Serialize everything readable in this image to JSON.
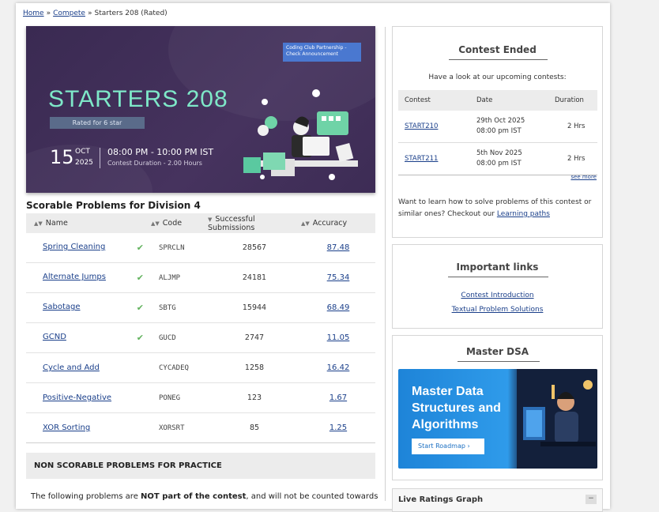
{
  "breadcrumb": {
    "home": "Home",
    "sep": "»",
    "compete": "Compete",
    "current": "Starters 208 (Rated)"
  },
  "banner": {
    "partner": "Coding Club Partnership - Check Announcement",
    "title": "STARTERS 208",
    "rated": "Rated for 6 star",
    "day": "15",
    "month": "OCT",
    "year": "2025",
    "time": "08:00 PM - 10:00 PM IST",
    "duration": "Contest Duration - 2.00 Hours"
  },
  "problems": {
    "section_title": "Scorable Problems for Division 4",
    "headers": {
      "name": "Name",
      "code": "Code",
      "subs": "Successful Submissions",
      "acc": "Accuracy"
    },
    "check": "✔",
    "rows": [
      {
        "name": "Spring Cleaning",
        "code": "SPRCLN",
        "subs": "28567",
        "acc": "87.48"
      },
      {
        "name": "Alternate Jumps",
        "code": "ALJMP",
        "subs": "24181",
        "acc": "75.34"
      },
      {
        "name": "Sabotage",
        "code": "SBTG",
        "subs": "15944",
        "acc": "68.49"
      },
      {
        "name": "GCND",
        "code": "GUCD",
        "subs": "2747",
        "acc": "11.05"
      },
      {
        "name": "Cycle and Add",
        "code": "CYCADEQ",
        "subs": "1258",
        "acc": "16.42"
      },
      {
        "name": "Positive-Negative",
        "code": "PONEG",
        "subs": "123",
        "acc": "1.67"
      },
      {
        "name": "XOR Sorting",
        "code": "XORSRT",
        "subs": "85",
        "acc": "1.25"
      }
    ]
  },
  "non_scorable": {
    "title": "NON SCORABLE PROBLEMS FOR PRACTICE",
    "text_pre": "The following problems are ",
    "text_bold": "NOT part of the contest",
    "text_post": ", and will not be counted towards"
  },
  "contest_ended": {
    "title": "Contest Ended",
    "subtitle": "Have a look at our upcoming contests:",
    "headers": {
      "contest": "Contest",
      "date": "Date",
      "duration": "Duration"
    },
    "rows": [
      {
        "contest": "START210",
        "date": "29th Oct 2025",
        "time": "08:00 pm IST",
        "duration": "2 Hrs"
      },
      {
        "contest": "START211",
        "date": "5th Nov 2025",
        "time": "08:00 pm IST",
        "duration": "2 Hrs"
      }
    ],
    "see_more": "see more",
    "learn_pre": "Want to learn how to solve problems of this contest or similar ones? Checkout our ",
    "learn_link": "Learning paths"
  },
  "important_links": {
    "title": "Important links",
    "link1": "Contest Introduction",
    "link2": "Textual Problem Solutions"
  },
  "master_dsa": {
    "title": "Master DSA",
    "line1": "Master Data",
    "line2": "Structures and",
    "line3": "Algorithms",
    "button": "Start Roadmap  ›"
  },
  "live_ratings": {
    "title": "Live Ratings Graph",
    "toggle": "−"
  },
  "colors": {
    "link": "#1a3f8a",
    "check": "#61b25d",
    "banner_bg": "#3a2a52",
    "banner_title": "#7ee8c8"
  }
}
